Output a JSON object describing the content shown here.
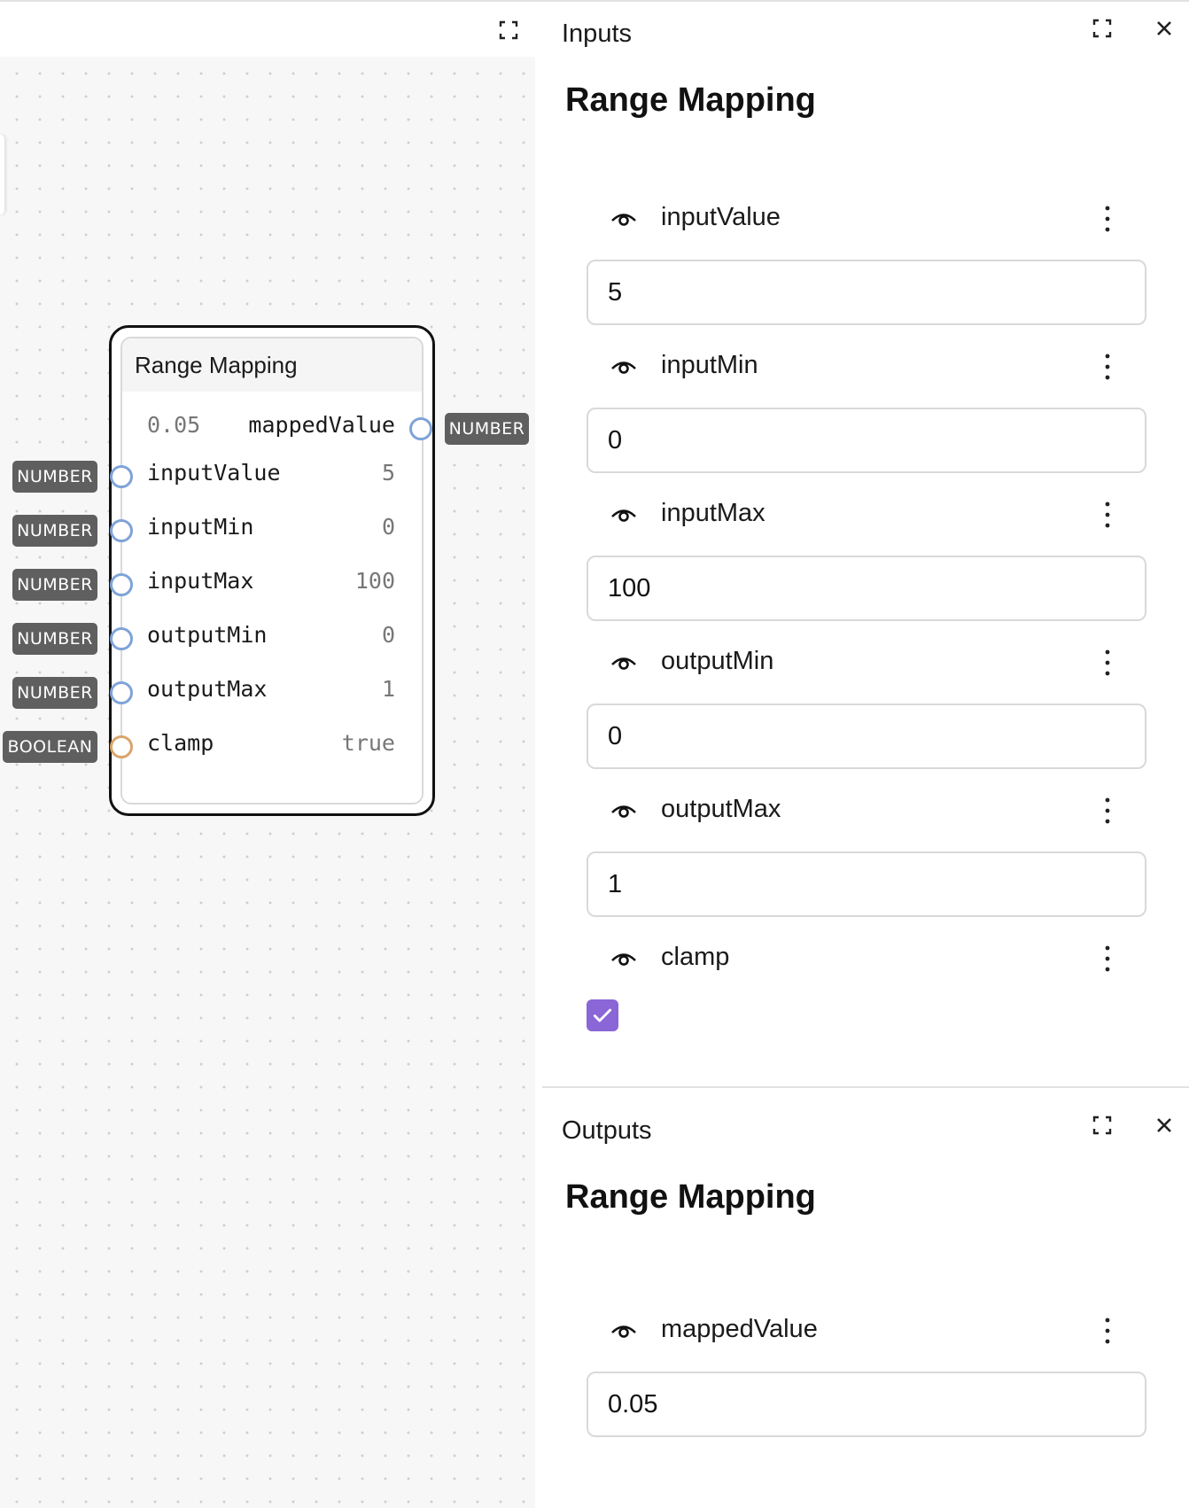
{
  "canvas": {
    "node": {
      "title": "Range Mapping",
      "output": {
        "name": "mappedValue",
        "value": "0.05",
        "type": "NUMBER"
      },
      "inputs": [
        {
          "name": "inputValue",
          "value": "5",
          "type": "NUMBER"
        },
        {
          "name": "inputMin",
          "value": "0",
          "type": "NUMBER"
        },
        {
          "name": "inputMax",
          "value": "100",
          "type": "NUMBER"
        },
        {
          "name": "outputMin",
          "value": "0",
          "type": "NUMBER"
        },
        {
          "name": "outputMax",
          "value": "1",
          "type": "NUMBER"
        },
        {
          "name": "clamp",
          "value": "true",
          "type": "BOOLEAN"
        }
      ]
    }
  },
  "inputs_panel": {
    "title": "Inputs",
    "heading": "Range Mapping",
    "fields": [
      {
        "label": "inputValue",
        "value": "5"
      },
      {
        "label": "inputMin",
        "value": "0"
      },
      {
        "label": "inputMax",
        "value": "100"
      },
      {
        "label": "outputMin",
        "value": "0"
      },
      {
        "label": "outputMax",
        "value": "1"
      }
    ],
    "clamp": {
      "label": "clamp",
      "checked": true
    }
  },
  "outputs_panel": {
    "title": "Outputs",
    "heading": "Range Mapping",
    "fields": [
      {
        "label": "mappedValue",
        "value": "0.05"
      }
    ]
  },
  "colors": {
    "port_number": "#7fa3d8",
    "port_boolean": "#d9a56b",
    "checkbox": "#8a66d6",
    "type_tag": "#5f5f5f"
  },
  "icons": [
    "expand-icon",
    "close-icon",
    "eye-icon",
    "kebab-menu-icon",
    "check-icon"
  ]
}
